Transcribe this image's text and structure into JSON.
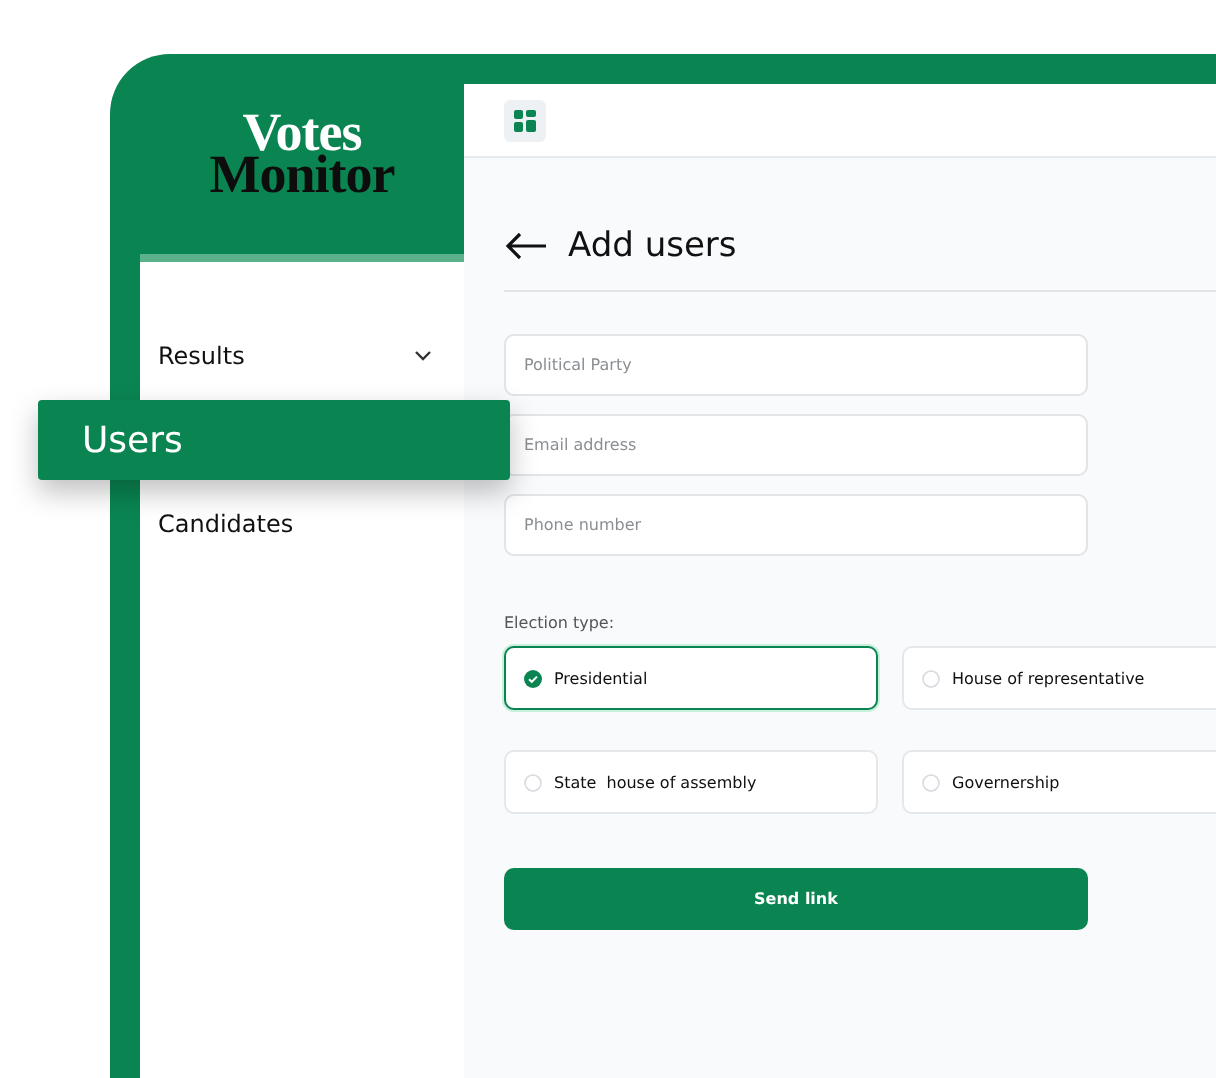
{
  "logo": {
    "line_1": "Votes",
    "line_2": "Monitor"
  },
  "sidebar": {
    "items": [
      {
        "label": "Results",
        "selected": false,
        "expandable": true
      },
      {
        "label": "Users",
        "selected": true,
        "expandable": false
      },
      {
        "label": "Candidates",
        "selected": false,
        "expandable": false
      }
    ]
  },
  "page": {
    "title": "Add users",
    "fields": [
      {
        "placeholder": "Political Party"
      },
      {
        "placeholder": "Email address"
      },
      {
        "placeholder": "Phone number"
      }
    ],
    "election_type": {
      "label": "Election type:",
      "options": [
        {
          "label": "Presidential",
          "selected": true
        },
        {
          "label": "House of representative",
          "selected": false
        },
        {
          "label": "State  house of assembly",
          "selected": false
        },
        {
          "label": "Governership",
          "selected": false
        }
      ]
    },
    "submit": "Send link"
  }
}
